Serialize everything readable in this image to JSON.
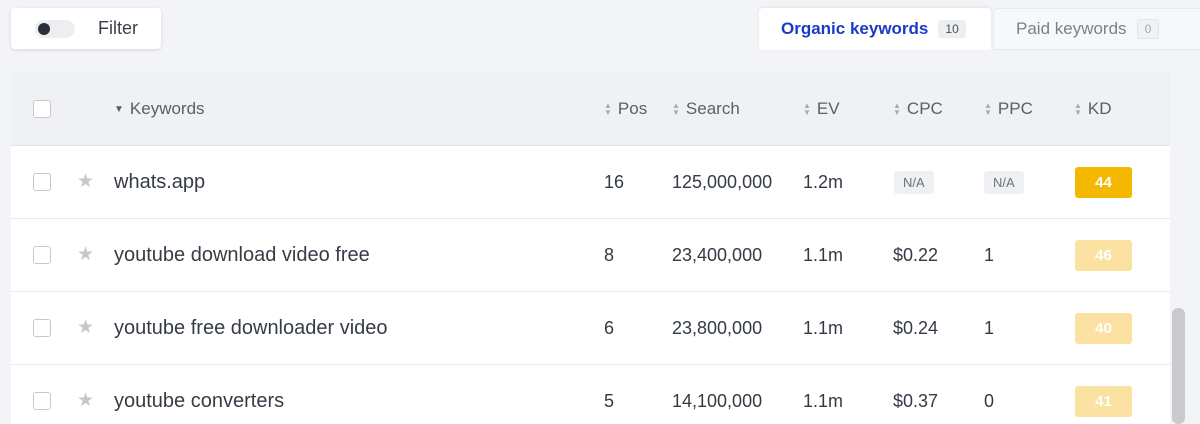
{
  "filter": {
    "label": "Filter"
  },
  "tabs": [
    {
      "label": "Organic keywords",
      "count": "10"
    },
    {
      "label": "Paid keywords",
      "count": "0"
    }
  ],
  "columns": {
    "keywords": "Keywords",
    "pos": "Pos",
    "search": "Search",
    "ev": "EV",
    "cpc": "CPC",
    "ppc": "PPC",
    "kd": "KD"
  },
  "rows": [
    {
      "keyword": "whats.app",
      "pos": "16",
      "search": "125,000,000",
      "ev": "1.2m",
      "cpc": "N/A",
      "ppc": "N/A",
      "kd": "44",
      "kd_color": "#f5b800"
    },
    {
      "keyword": "youtube download video free",
      "pos": "8",
      "search": "23,400,000",
      "ev": "1.1m",
      "cpc": "$0.22",
      "ppc": "1",
      "kd": "46",
      "kd_color": "#fbe1a2"
    },
    {
      "keyword": "youtube free downloader video",
      "pos": "6",
      "search": "23,800,000",
      "ev": "1.1m",
      "cpc": "$0.24",
      "ppc": "1",
      "kd": "40",
      "kd_color": "#fbe1a2"
    },
    {
      "keyword": "youtube converters",
      "pos": "5",
      "search": "14,100,000",
      "ev": "1.1m",
      "cpc": "$0.37",
      "ppc": "0",
      "kd": "41",
      "kd_color": "#fbe1a2"
    }
  ],
  "colors": {
    "accent": "#1a3cc4",
    "kd_hard": "#f5b800",
    "kd_medium": "#fbe1a2"
  }
}
